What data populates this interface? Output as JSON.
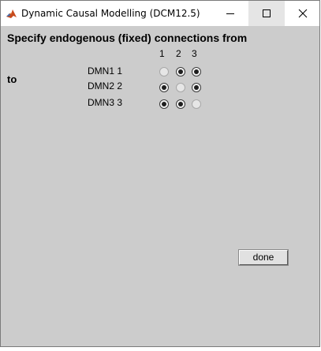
{
  "window": {
    "title": "Dynamic Causal Modelling (DCM12.5)",
    "icon": "matlab-icon",
    "controls": [
      "minimize-icon",
      "maximize-icon",
      "close-icon"
    ]
  },
  "dialog": {
    "heading": "Specify endogenous (fixed) connections from",
    "to_label": "to",
    "columns": [
      "1",
      "2",
      "3"
    ],
    "rows": [
      {
        "label": "DMN1 1",
        "cells": [
          "disabled",
          "checked",
          "checked"
        ]
      },
      {
        "label": "DMN2 2",
        "cells": [
          "checked",
          "disabled",
          "checked"
        ]
      },
      {
        "label": "DMN3 3",
        "cells": [
          "checked",
          "checked",
          "disabled"
        ]
      }
    ],
    "done_label": "done"
  },
  "colors": {
    "panel_background": "#cccccc",
    "titlebar_background": "#ffffff"
  }
}
